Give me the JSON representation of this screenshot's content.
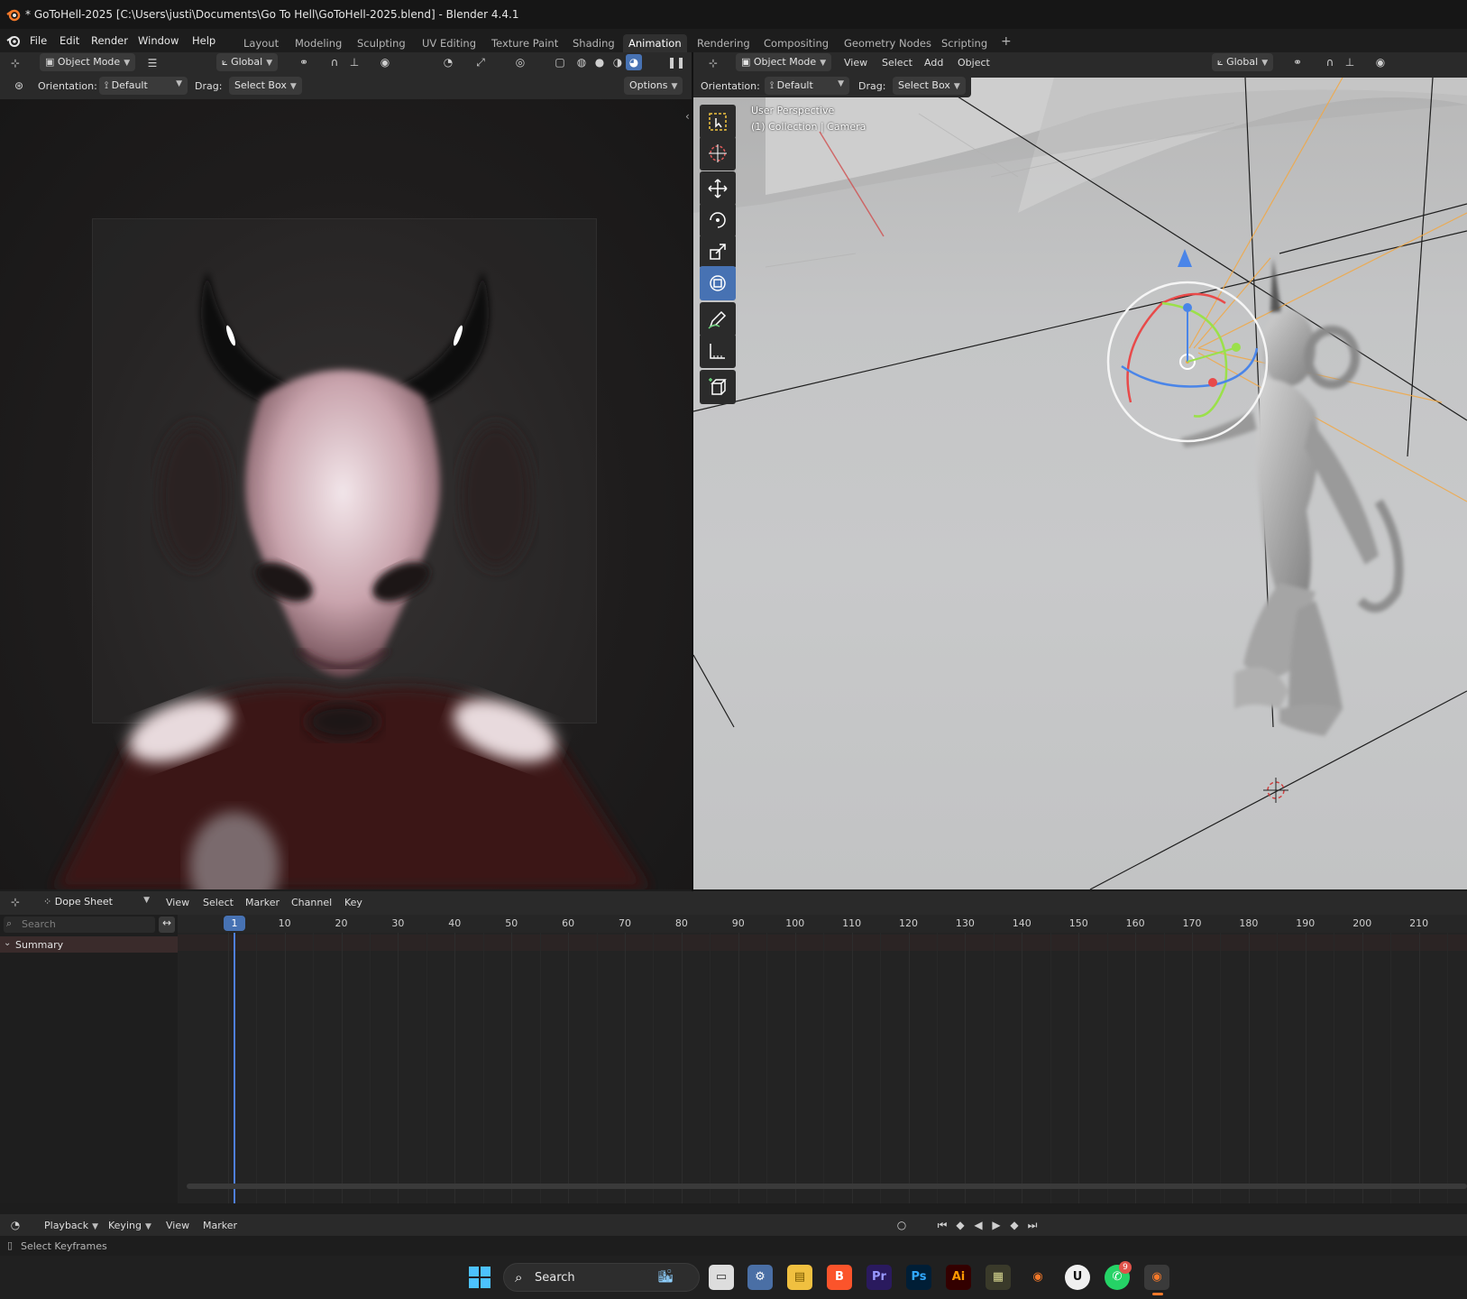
{
  "titlebar": {
    "title": "* GoToHell-2025 [C:\\Users\\justi\\Documents\\Go To Hell\\GoToHell-2025.blend] - Blender 4.4.1"
  },
  "menu": {
    "items": [
      "File",
      "Edit",
      "Render",
      "Window",
      "Help"
    ]
  },
  "workspaces": {
    "tabs": [
      "Layout",
      "Modeling",
      "Sculpting",
      "UV Editing",
      "Texture Paint",
      "Shading",
      "Animation",
      "Rendering",
      "Compositing",
      "Geometry Nodes",
      "Scripting"
    ],
    "active": "Animation",
    "add": "+"
  },
  "left_view": {
    "mode": "Object Mode",
    "transform": "Global",
    "orientation_label": "Orientation:",
    "orientation_value": "Default",
    "drag_label": "Drag:",
    "drag_value": "Select Box",
    "options": "Options"
  },
  "right_view": {
    "mode": "Object Mode",
    "menus": [
      "View",
      "Select",
      "Add",
      "Object"
    ],
    "transform": "Global",
    "orientation_label": "Orientation:",
    "orientation_value": "Default",
    "drag_label": "Drag:",
    "drag_value": "Select Box",
    "overlay_line1": "User Perspective",
    "overlay_line2": "(1) Collection | Camera"
  },
  "dope_sheet": {
    "editor": "Dope Sheet",
    "menus": [
      "View",
      "Select",
      "Marker",
      "Channel",
      "Key"
    ],
    "search_placeholder": "Search",
    "summary": "Summary",
    "current_frame": "1",
    "ruler": [
      "10",
      "20",
      "30",
      "40",
      "50",
      "60",
      "70",
      "80",
      "90",
      "100",
      "110",
      "120",
      "130",
      "140",
      "150",
      "160",
      "170",
      "180",
      "190",
      "200",
      "210"
    ]
  },
  "timeline": {
    "menus": [
      "Playback",
      "Keying",
      "View",
      "Marker"
    ]
  },
  "status": {
    "text": "Select Keyframes"
  },
  "taskbar": {
    "search": "Search",
    "notification_badge": "9"
  },
  "colors": {
    "accent": "#4772b3",
    "header": "#2a2a2a",
    "background": "#1d1d1d"
  }
}
